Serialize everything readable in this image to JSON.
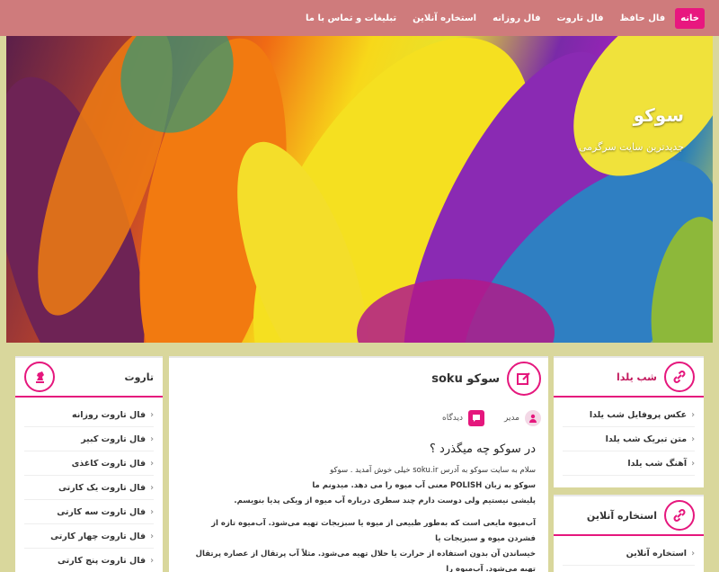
{
  "nav": {
    "items": [
      {
        "label": "خانه",
        "active": true
      },
      {
        "label": "فال حافظ",
        "active": false
      },
      {
        "label": "فال تاروت",
        "active": false
      },
      {
        "label": "فال روزانه",
        "active": false
      },
      {
        "label": "استخاره آنلاین",
        "active": false
      },
      {
        "label": "تبلیغات و تماس با ما",
        "active": false
      }
    ]
  },
  "hero": {
    "title": "سوکو",
    "tagline": "جدیدترین سایت سرگرمی"
  },
  "left_panel": {
    "title": "تاروت",
    "icon": "chess-knight-icon",
    "items": [
      "فال تاروت روزانه",
      "فال تاروت کبیر",
      "فال تاروت کاغذی",
      "فال تاروت یک کارتی",
      "فال تاروت سه کارتی",
      "فال تاروت چهار کارتی",
      "فال تاروت پنج کارتی"
    ]
  },
  "main": {
    "title": "سوکو soku",
    "icon": "edit-icon",
    "author": "مدیر",
    "comments": "دیدگاه",
    "heading": "در سوکو چه میگذرد ؟",
    "paragraphs": [
      "سلام به سایت سوکو به آدرس soku.ir خیلی خوش آمدید . سوکو",
      "سوکو به زبان POLISH معنی آب میوه را می دهد. میدونم ما",
      "پلیشی نیستیم ولی دوست دارم چند سطری درباره آب میوه از ویکی پدیا بنویسم.",
      "آب‌میوه مایعی است که به‌طور طبیعی از میوه یا سبزیجات تهیه می‌شود. آب‌میوه تازه از فشردن میوه و سبزیجات یا",
      "خیساندن آن بدون استفاده از حرارت یا حلال تهیه می‌شود. مثلاً آب پرتقال از عصاره پرتقال تهیه می‌شود. آب‌میوه را"
    ]
  },
  "right_panel_1": {
    "title": "شب یلدا",
    "icon": "link-icon",
    "items": [
      "عکس پروفایل شب یلدا",
      "متن تبریک شب یلدا",
      "آهنگ شب یلدا"
    ]
  },
  "right_panel_2": {
    "title": "استخاره آنلاین",
    "icon": "link-icon",
    "items": [
      "استخاره آنلاین"
    ]
  },
  "colors": {
    "accent": "#e5177d",
    "nav_bg": "#cf7b7c",
    "page_bg": "#d9d79c"
  }
}
